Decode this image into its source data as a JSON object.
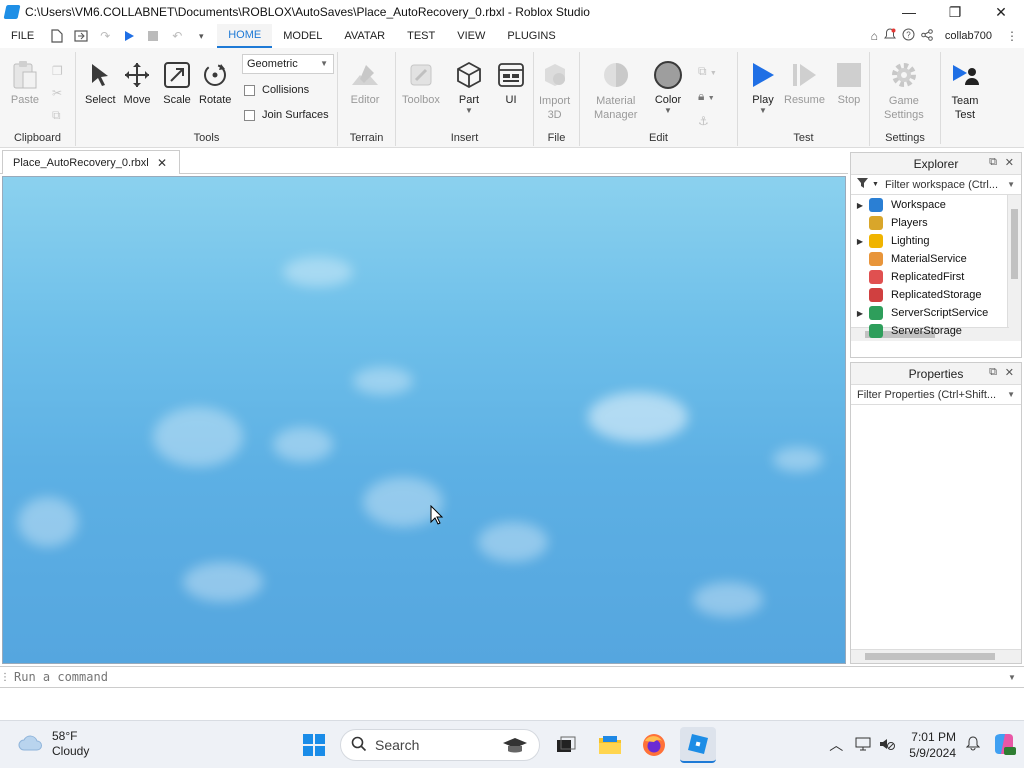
{
  "window": {
    "title": "C:\\Users\\VM6.COLLABNET\\Documents\\ROBLOX\\AutoSaves\\Place_AutoRecovery_0.rbxl - Roblox Studio",
    "minimize": "—",
    "maximize": "❐",
    "close": "✕"
  },
  "menu": {
    "file": "FILE",
    "tabs": [
      "HOME",
      "MODEL",
      "AVATAR",
      "TEST",
      "VIEW",
      "PLUGINS"
    ],
    "active_tab": "HOME",
    "username": "collab700"
  },
  "ribbon": {
    "clipboard": {
      "label": "Clipboard",
      "paste": "Paste"
    },
    "tools": {
      "label": "Tools",
      "select": "Select",
      "move": "Move",
      "scale": "Scale",
      "rotate": "Rotate",
      "mode_value": "Geometric",
      "collisions": "Collisions",
      "join_surfaces": "Join Surfaces"
    },
    "terrain": {
      "label": "Terrain",
      "editor": "Editor"
    },
    "insert": {
      "label": "Insert",
      "toolbox": "Toolbox",
      "part": "Part",
      "ui": "UI"
    },
    "file": {
      "label": "File",
      "import_line1": "Import",
      "import_line2": "3D"
    },
    "edit": {
      "label": "Edit",
      "material_line1": "Material",
      "material_line2": "Manager",
      "color": "Color"
    },
    "test": {
      "label": "Test",
      "play": "Play",
      "resume": "Resume",
      "stop": "Stop"
    },
    "settings": {
      "label": "Settings",
      "game_line1": "Game",
      "game_line2": "Settings",
      "team_line1": "Team",
      "team_line2": "Test"
    }
  },
  "document": {
    "tab": "Place_AutoRecovery_0.rbxl",
    "close": "✕"
  },
  "explorer": {
    "title": "Explorer",
    "filter": "Filter workspace (Ctrl...",
    "items": [
      {
        "label": "Workspace",
        "expandable": true,
        "color": "#2a7fd4"
      },
      {
        "label": "Players",
        "expandable": false,
        "color": "#d9a62a"
      },
      {
        "label": "Lighting",
        "expandable": true,
        "color": "#f0b400"
      },
      {
        "label": "MaterialService",
        "expandable": false,
        "color": "#e8953a"
      },
      {
        "label": "ReplicatedFirst",
        "expandable": false,
        "color": "#e05050"
      },
      {
        "label": "ReplicatedStorage",
        "expandable": false,
        "color": "#d04040"
      },
      {
        "label": "ServerScriptService",
        "expandable": true,
        "color": "#2e9e5b"
      },
      {
        "label": "ServerStorage",
        "expandable": false,
        "color": "#2e9e5b"
      }
    ]
  },
  "properties": {
    "title": "Properties",
    "filter": "Filter Properties (Ctrl+Shift..."
  },
  "command": {
    "placeholder": "Run a command"
  },
  "taskbar": {
    "temp": "58°F",
    "condition": "Cloudy",
    "search": "Search",
    "time": "7:01 PM",
    "date": "5/9/2024"
  },
  "colors": {
    "accent": "#1e7ad6",
    "play": "#1f6fe5",
    "sky": "#5db0e4"
  }
}
